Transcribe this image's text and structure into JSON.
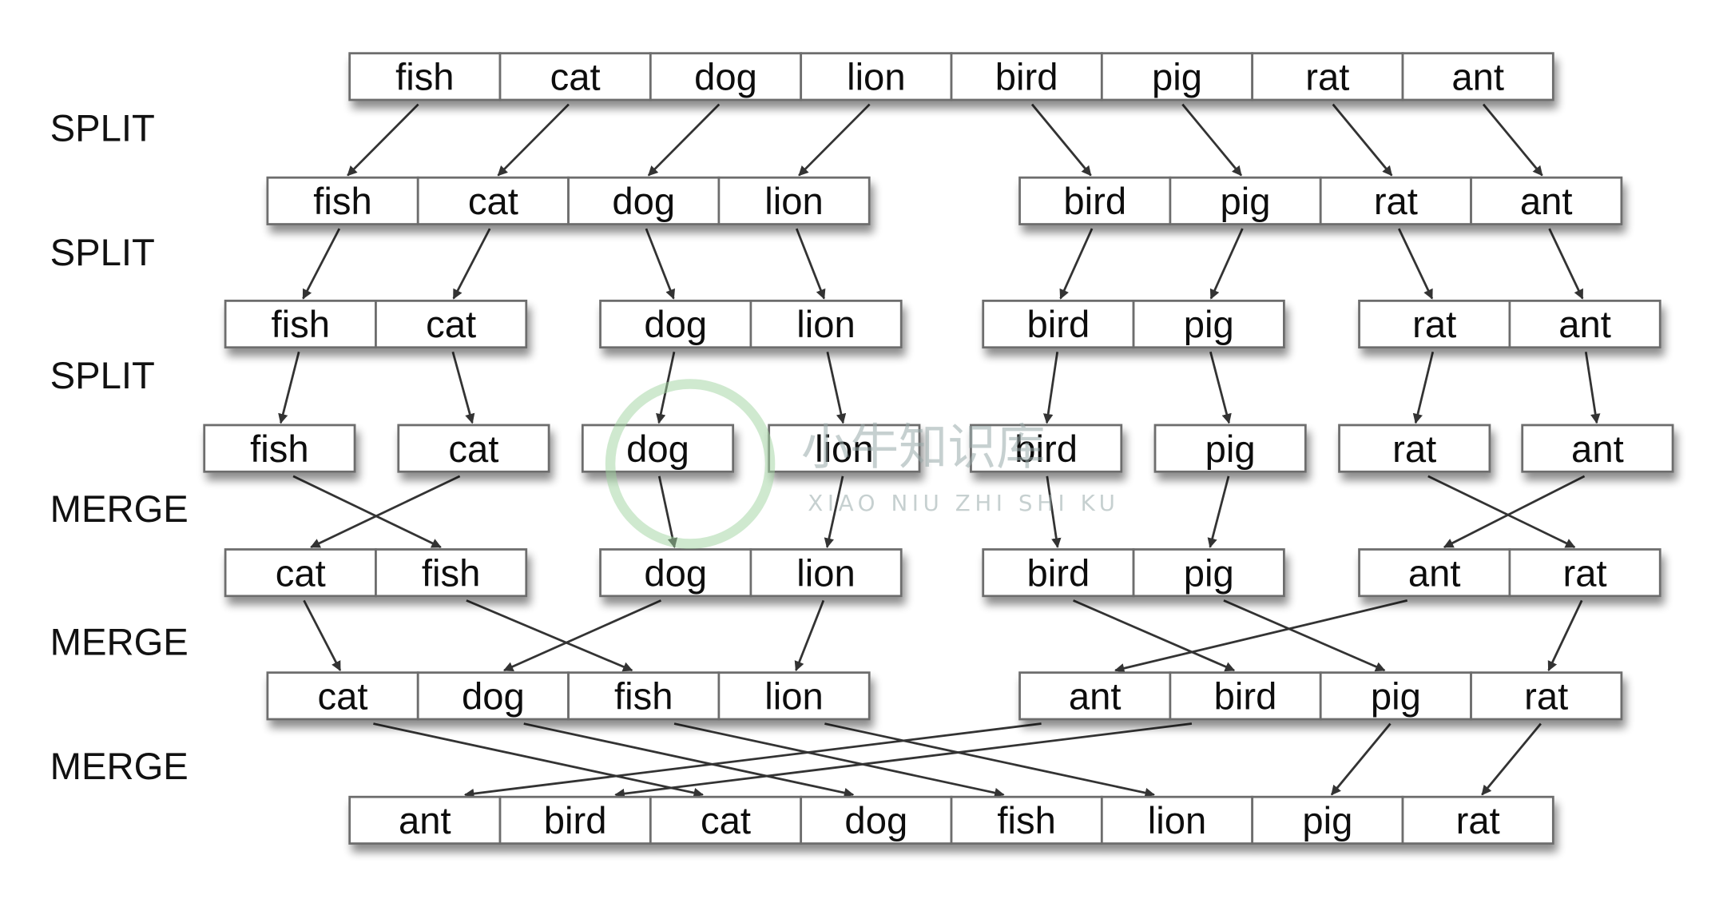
{
  "stage_labels": [
    "SPLIT",
    "SPLIT",
    "SPLIT",
    "MERGE",
    "MERGE",
    "MERGE"
  ],
  "rows": [
    [
      [
        "fish",
        "cat",
        "dog",
        "lion",
        "bird",
        "pig",
        "rat",
        "ant"
      ]
    ],
    [
      [
        "fish",
        "cat",
        "dog",
        "lion"
      ],
      [
        "bird",
        "pig",
        "rat",
        "ant"
      ]
    ],
    [
      [
        "fish",
        "cat"
      ],
      [
        "dog",
        "lion"
      ],
      [
        "bird",
        "pig"
      ],
      [
        "rat",
        "ant"
      ]
    ],
    [
      [
        "fish"
      ],
      [
        "cat"
      ],
      [
        "dog"
      ],
      [
        "lion"
      ],
      [
        "bird"
      ],
      [
        "pig"
      ],
      [
        "rat"
      ],
      [
        "ant"
      ]
    ],
    [
      [
        "cat",
        "fish"
      ],
      [
        "dog",
        "lion"
      ],
      [
        "bird",
        "pig"
      ],
      [
        "ant",
        "rat"
      ]
    ],
    [
      [
        "cat",
        "dog",
        "fish",
        "lion"
      ],
      [
        "ant",
        "bird",
        "pig",
        "rat"
      ]
    ],
    [
      [
        "ant",
        "bird",
        "cat",
        "dog",
        "fish",
        "lion",
        "pig",
        "rat"
      ]
    ]
  ],
  "watermark": {
    "title": "小牛知识库",
    "subtitle": "XIAO NIU ZHI SHI KU"
  },
  "colors": {
    "arrow": "#333333",
    "cell_border": "#6d6d6d",
    "watermark": "#5fc4b8"
  }
}
